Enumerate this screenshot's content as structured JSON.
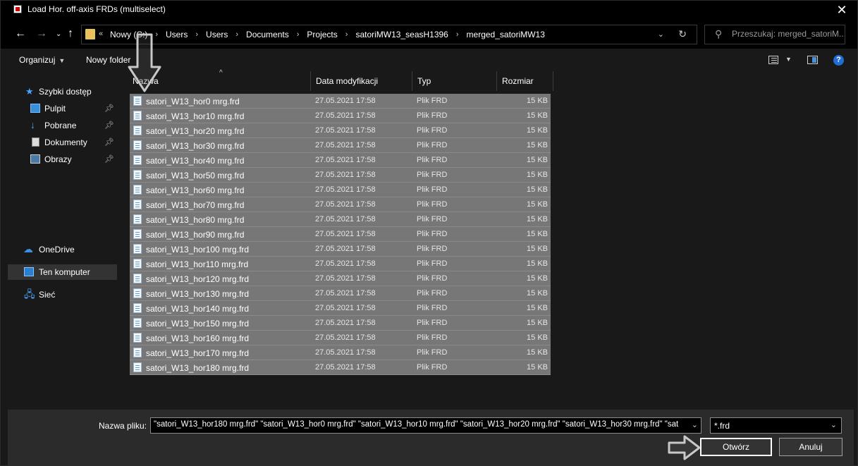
{
  "window": {
    "title": "Load Hor. off-axis FRDs (multiselect)",
    "close_glyph": "✕"
  },
  "address": {
    "ellipsis": "«",
    "crumbs": [
      "Nowy (C:)",
      "Users",
      "Users",
      "Documents",
      "Projects",
      "satoriMW13_seasH1396",
      "merged_satoriMW13"
    ],
    "separator": "›"
  },
  "search": {
    "placeholder": "Przeszukaj: merged_satoriM..."
  },
  "toolbar": {
    "organize_label": "Organizuj",
    "new_folder_label": "Nowy folder",
    "help_label": "?"
  },
  "sidebar": {
    "items": [
      {
        "label": "Szybki dostęp",
        "icon": "star-icon"
      },
      {
        "label": "Pulpit",
        "icon": "desktop-icon"
      },
      {
        "label": "Pobrane",
        "icon": "download-icon"
      },
      {
        "label": "Dokumenty",
        "icon": "documents-icon"
      },
      {
        "label": "Obrazy",
        "icon": "pictures-icon"
      },
      {
        "label": "OneDrive",
        "icon": "cloud-icon"
      },
      {
        "label": "Ten komputer",
        "icon": "computer-icon"
      },
      {
        "label": "Sieć",
        "icon": "network-icon"
      }
    ]
  },
  "columns": {
    "name": "Nazwa",
    "date": "Data modyfikacji",
    "type": "Typ",
    "size": "Rozmiar"
  },
  "files": [
    {
      "name": "satori_W13_hor0 mrg.frd",
      "date": "27.05.2021 17:58",
      "type": "Plik FRD",
      "size": "15 KB"
    },
    {
      "name": "satori_W13_hor10 mrg.frd",
      "date": "27.05.2021 17:58",
      "type": "Plik FRD",
      "size": "15 KB"
    },
    {
      "name": "satori_W13_hor20 mrg.frd",
      "date": "27.05.2021 17:58",
      "type": "Plik FRD",
      "size": "15 KB"
    },
    {
      "name": "satori_W13_hor30 mrg.frd",
      "date": "27.05.2021 17:58",
      "type": "Plik FRD",
      "size": "15 KB"
    },
    {
      "name": "satori_W13_hor40 mrg.frd",
      "date": "27.05.2021 17:58",
      "type": "Plik FRD",
      "size": "15 KB"
    },
    {
      "name": "satori_W13_hor50 mrg.frd",
      "date": "27.05.2021 17:58",
      "type": "Plik FRD",
      "size": "15 KB"
    },
    {
      "name": "satori_W13_hor60 mrg.frd",
      "date": "27.05.2021 17:58",
      "type": "Plik FRD",
      "size": "15 KB"
    },
    {
      "name": "satori_W13_hor70 mrg.frd",
      "date": "27.05.2021 17:58",
      "type": "Plik FRD",
      "size": "15 KB"
    },
    {
      "name": "satori_W13_hor80 mrg.frd",
      "date": "27.05.2021 17:58",
      "type": "Plik FRD",
      "size": "15 KB"
    },
    {
      "name": "satori_W13_hor90 mrg.frd",
      "date": "27.05.2021 17:58",
      "type": "Plik FRD",
      "size": "15 KB"
    },
    {
      "name": "satori_W13_hor100 mrg.frd",
      "date": "27.05.2021 17:58",
      "type": "Plik FRD",
      "size": "15 KB"
    },
    {
      "name": "satori_W13_hor110 mrg.frd",
      "date": "27.05.2021 17:58",
      "type": "Plik FRD",
      "size": "15 KB"
    },
    {
      "name": "satori_W13_hor120 mrg.frd",
      "date": "27.05.2021 17:58",
      "type": "Plik FRD",
      "size": "15 KB"
    },
    {
      "name": "satori_W13_hor130 mrg.frd",
      "date": "27.05.2021 17:58",
      "type": "Plik FRD",
      "size": "15 KB"
    },
    {
      "name": "satori_W13_hor140 mrg.frd",
      "date": "27.05.2021 17:58",
      "type": "Plik FRD",
      "size": "15 KB"
    },
    {
      "name": "satori_W13_hor150 mrg.frd",
      "date": "27.05.2021 17:58",
      "type": "Plik FRD",
      "size": "15 KB"
    },
    {
      "name": "satori_W13_hor160 mrg.frd",
      "date": "27.05.2021 17:58",
      "type": "Plik FRD",
      "size": "15 KB"
    },
    {
      "name": "satori_W13_hor170 mrg.frd",
      "date": "27.05.2021 17:58",
      "type": "Plik FRD",
      "size": "15 KB"
    },
    {
      "name": "satori_W13_hor180 mrg.frd",
      "date": "27.05.2021 17:58",
      "type": "Plik FRD",
      "size": "15 KB"
    }
  ],
  "footer": {
    "filename_label": "Nazwa pliku:",
    "filename_value": "\"satori_W13_hor180 mrg.frd\" \"satori_W13_hor0 mrg.frd\" \"satori_W13_hor10 mrg.frd\" \"satori_W13_hor20 mrg.frd\" \"satori_W13_hor30 mrg.frd\" \"sat",
    "filter_value": "*.frd",
    "open_label": "Otwórz",
    "cancel_label": "Anuluj"
  },
  "colors": {
    "selected_row": "#777777",
    "accent": "#1e6ed6"
  }
}
